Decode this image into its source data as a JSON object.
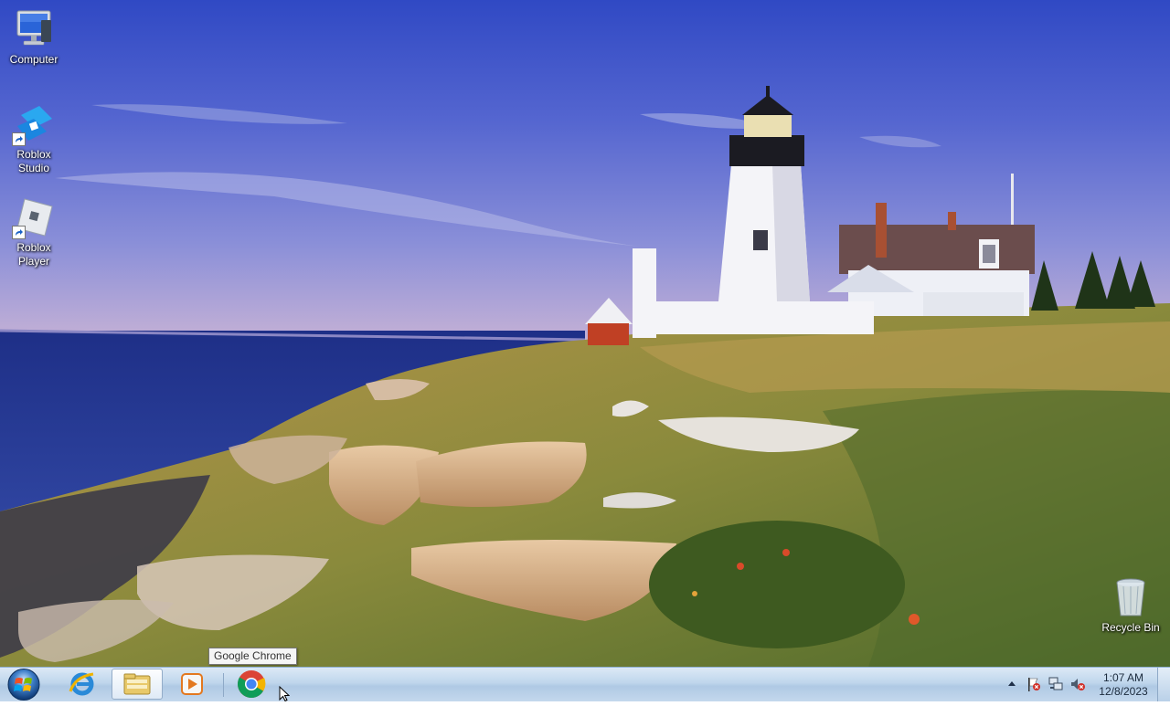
{
  "desktop": {
    "icons": [
      {
        "label": "Computer",
        "icon": "computer-icon"
      },
      {
        "label_line1": "Roblox",
        "label_line2": "Studio",
        "icon": "roblox-studio-icon"
      },
      {
        "label": "Roblox Player",
        "icon": "roblox-player-icon"
      },
      {
        "label": "Recycle Bin",
        "icon": "recycle-bin-icon"
      }
    ],
    "wallpaper": "lighthouse-coast"
  },
  "tooltip": {
    "text": "Google Chrome"
  },
  "taskbar": {
    "start": "windows-start-orb",
    "pinned": [
      {
        "name": "Internet Explorer",
        "icon": "internet-explorer-icon"
      },
      {
        "name": "Windows Explorer",
        "icon": "file-explorer-icon",
        "active": true
      },
      {
        "name": "Windows Media Player",
        "icon": "media-player-icon"
      },
      {
        "name": "Google Chrome",
        "icon": "chrome-icon"
      }
    ],
    "tray": {
      "icons": [
        "show-hidden-icons-arrow",
        "action-center-flag-icon",
        "network-icon",
        "volume-muted-icon"
      ],
      "time": "1:07 AM",
      "date": "12/8/2023"
    }
  },
  "colors": {
    "sky_top": "#3c55c8",
    "sea": "#23338a",
    "taskbar": "#bfd6ec"
  }
}
